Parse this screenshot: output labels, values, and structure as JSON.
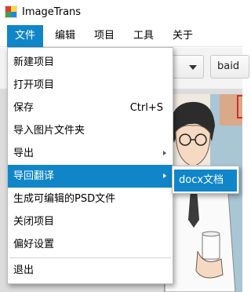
{
  "app": {
    "title": "ImageTrans",
    "icon": "app-logo-icon"
  },
  "menubar": {
    "items": [
      {
        "label": "文件",
        "active": true
      },
      {
        "label": "编辑",
        "active": false
      },
      {
        "label": "项目",
        "active": false
      },
      {
        "label": "工具",
        "active": false
      },
      {
        "label": "关于",
        "active": false
      }
    ]
  },
  "toolbar": {
    "combo_right_text": "baid"
  },
  "file_menu": {
    "items": [
      {
        "label": "新建项目"
      },
      {
        "label": "打开项目"
      },
      {
        "label": "保存",
        "shortcut": "Ctrl+S"
      },
      {
        "label": "导入图片文件夹"
      },
      {
        "label": "导出",
        "submenu": true
      },
      {
        "label": "导回翻译",
        "submenu": true,
        "highlighted": true
      },
      {
        "label": "生成可编辑的PSD文件"
      },
      {
        "label": "关闭项目"
      },
      {
        "label": "偏好设置"
      },
      {
        "label": "退出"
      }
    ]
  },
  "submenu": {
    "items": [
      {
        "label": "docx文档",
        "highlighted": true
      }
    ]
  },
  "colors": {
    "accent": "#1086c8"
  }
}
